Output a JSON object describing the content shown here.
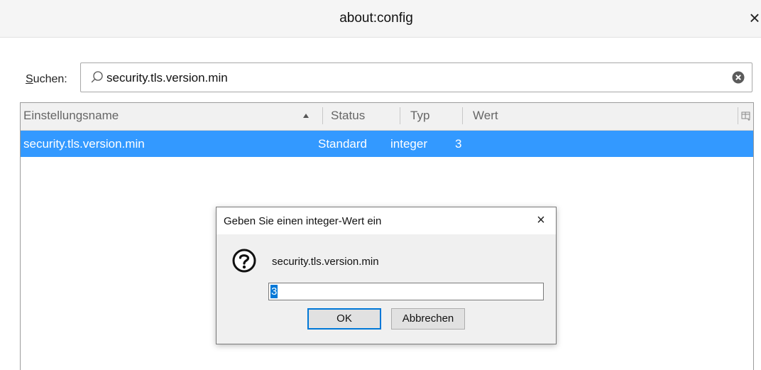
{
  "window": {
    "title": "about:config",
    "close_glyph": "×"
  },
  "search": {
    "label_accel": "S",
    "label_rest": "uchen:",
    "value": "security.tls.version.min",
    "icons": {
      "search": "search-icon",
      "clear": "clear-icon"
    }
  },
  "table": {
    "columns": [
      "Einstellungsname",
      "Status",
      "Typ",
      "Wert"
    ],
    "sort_icon": "sort-ascending-icon",
    "column_picker_icon": "column-picker-icon",
    "rows": [
      {
        "name": "security.tls.version.min",
        "status": "Standard",
        "typ": "integer",
        "wert": "3",
        "selected": true
      }
    ]
  },
  "dialog": {
    "title": "Geben Sie einen integer-Wert ein",
    "close_glyph": "×",
    "icon": "question-icon",
    "message": "security.tls.version.min",
    "input_value": "3",
    "ok_label": "OK",
    "cancel_label": "Abbrechen"
  },
  "colors": {
    "selection": "#3399ff",
    "focus": "#0078d7"
  }
}
